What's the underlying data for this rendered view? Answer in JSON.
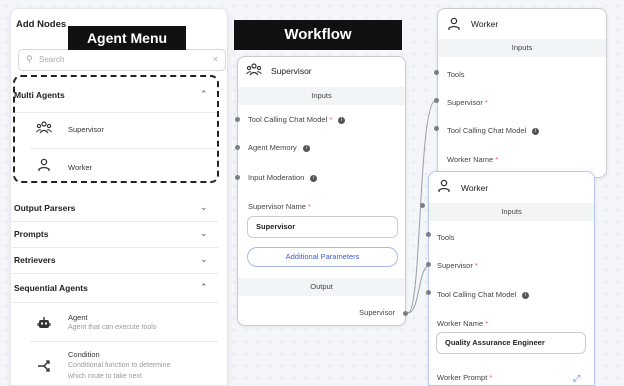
{
  "add_nodes": {
    "title": "Add Nodes",
    "search_placeholder": "Search",
    "clear_glyph": "×",
    "overlay_label": "Agent Menu",
    "sections": [
      {
        "label": "Multi Agents",
        "chevron": "⌃"
      },
      {
        "label": "Output Parsers",
        "chevron": "⌄"
      },
      {
        "label": "Prompts",
        "chevron": "⌄"
      },
      {
        "label": "Retrievers",
        "chevron": "⌄"
      },
      {
        "label": "Sequential Agents",
        "chevron": "⌃"
      }
    ],
    "multi_agents": [
      {
        "label": "Supervisor",
        "icon": "supervisor-icon"
      },
      {
        "label": "Worker",
        "icon": "worker-icon"
      }
    ],
    "sequential_agents": [
      {
        "label": "Agent",
        "description": "Agent that can execute tools",
        "icon": "robot-icon"
      },
      {
        "label": "Condition",
        "description_line1": "Conditional function to determine",
        "description_line2": "which route to take next",
        "icon": "split-arrow-icon"
      }
    ]
  },
  "workflow": {
    "overlay_label": "Workflow",
    "supervisor_node": {
      "title": "Supervisor",
      "inputs_label": "Inputs",
      "fields": [
        {
          "label": "Tool Calling Chat Model",
          "required": "*"
        },
        {
          "label": "Agent Memory",
          "required": ""
        },
        {
          "label": "Input Moderation",
          "required": ""
        }
      ],
      "name_label": "Supervisor Name",
      "name_required": "*",
      "name_value": "Supervisor",
      "additional_params": "Additional Parameters",
      "output_label": "Output",
      "output_value": "Supervisor"
    },
    "worker_node_top": {
      "title": "Worker",
      "inputs_label": "Inputs",
      "fields": [
        {
          "label": "Tools",
          "required": ""
        },
        {
          "label": "Supervisor",
          "required": "*"
        },
        {
          "label": "Tool Calling Chat Model",
          "required": ""
        }
      ],
      "name_label": "Worker Name",
      "name_required": "*"
    },
    "worker_node_bottom": {
      "title": "Worker",
      "inputs_label": "Inputs",
      "fields": [
        {
          "label": "Tools",
          "required": ""
        },
        {
          "label": "Supervisor",
          "required": "*"
        },
        {
          "label": "Tool Calling Chat Model",
          "required": ""
        }
      ],
      "name_label": "Worker Name",
      "name_required": "*",
      "name_value": "Quality Assurance Engineer",
      "prompt_label": "Worker Prompt",
      "prompt_required": "*"
    }
  },
  "colors": {
    "accent": "#3c5bd6",
    "required": "#e25c5c",
    "overlay_bg": "#111111"
  }
}
